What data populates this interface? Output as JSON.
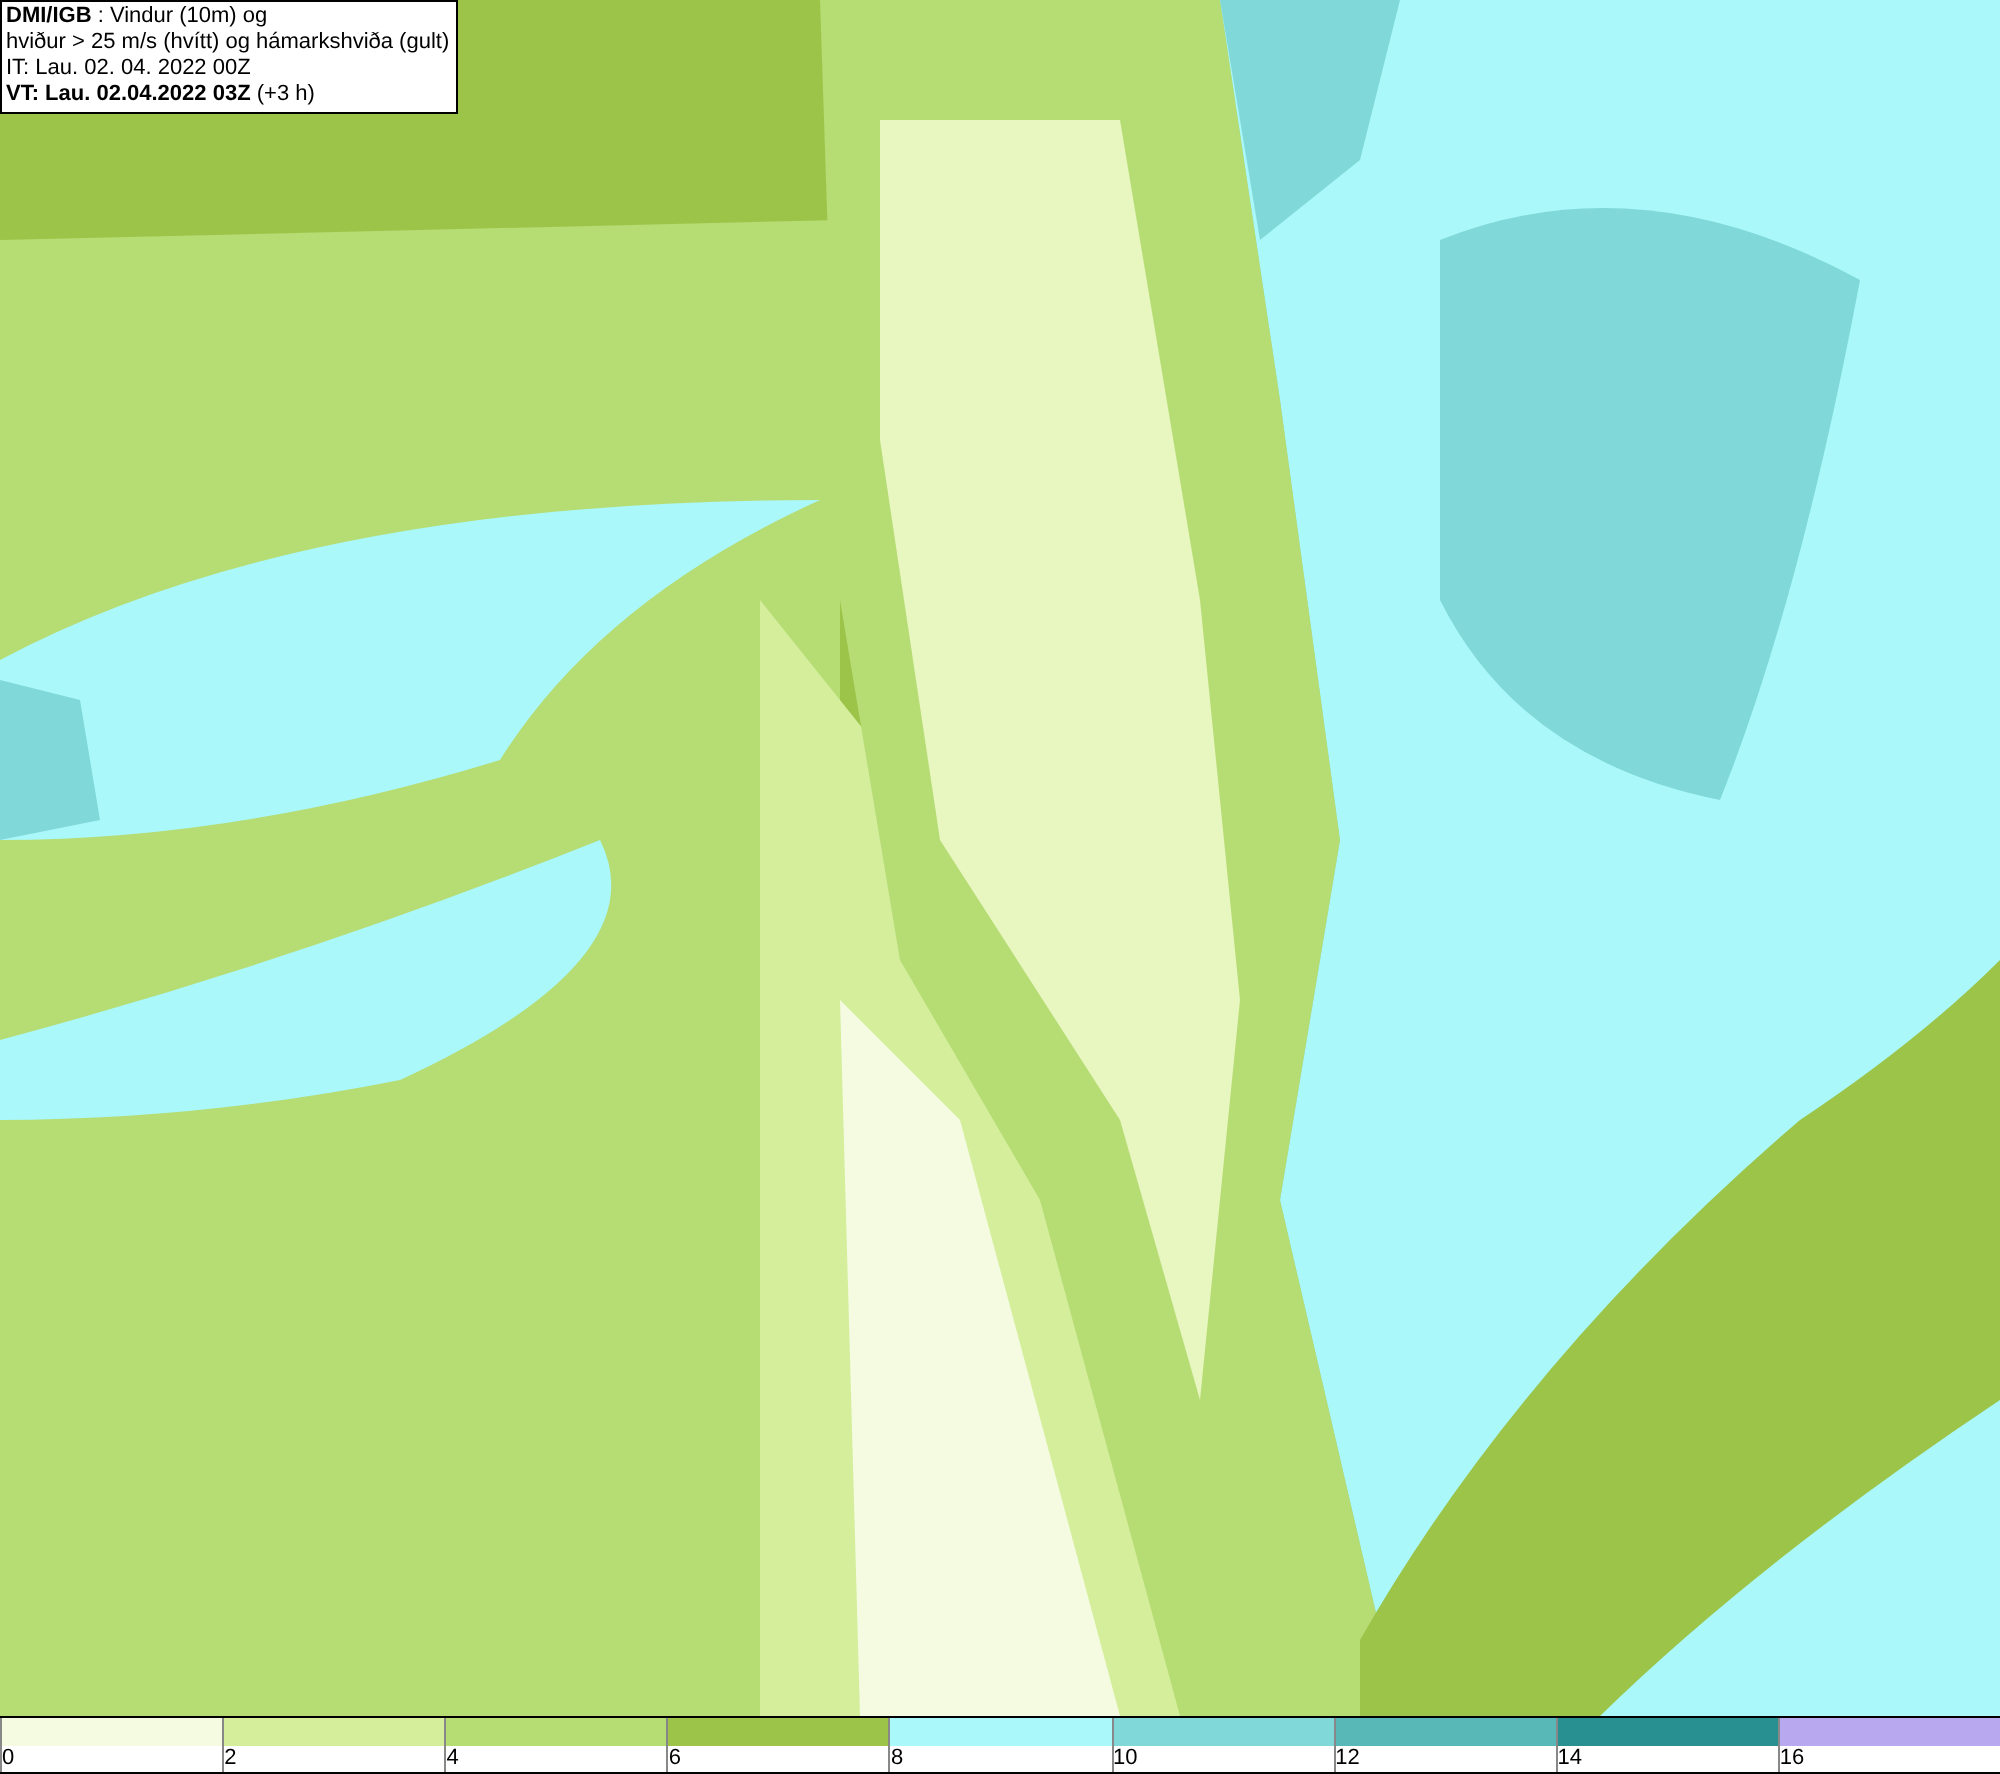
{
  "header": {
    "lines": [
      "**DMI/IGB** : Vindur (10m) og",
      "hviður > 25 m/s (hvítt) og hámarkshviða (gult)",
      "IT: Lau. 02. 04. 2022 00Z",
      "**VT: Lau. 02.04.2022 03Z** (+3 h)"
    ]
  },
  "legend": {
    "bins": [
      {
        "color": "#f4fbe0",
        "label": "0"
      },
      {
        "color": "#d4ee9c",
        "label": "2"
      },
      {
        "color": "#b6dc74",
        "label": "4"
      },
      {
        "color": "#9cc448",
        "label": "6"
      },
      {
        "color": "#aaf8fa",
        "label": "8"
      },
      {
        "color": "#80d8d8",
        "label": "10"
      },
      {
        "color": "#58b8b8",
        "label": "12"
      },
      {
        "color": "#289090",
        "label": "14"
      },
      {
        "color": "#b8a8f0",
        "label": "16"
      }
    ]
  }
}
